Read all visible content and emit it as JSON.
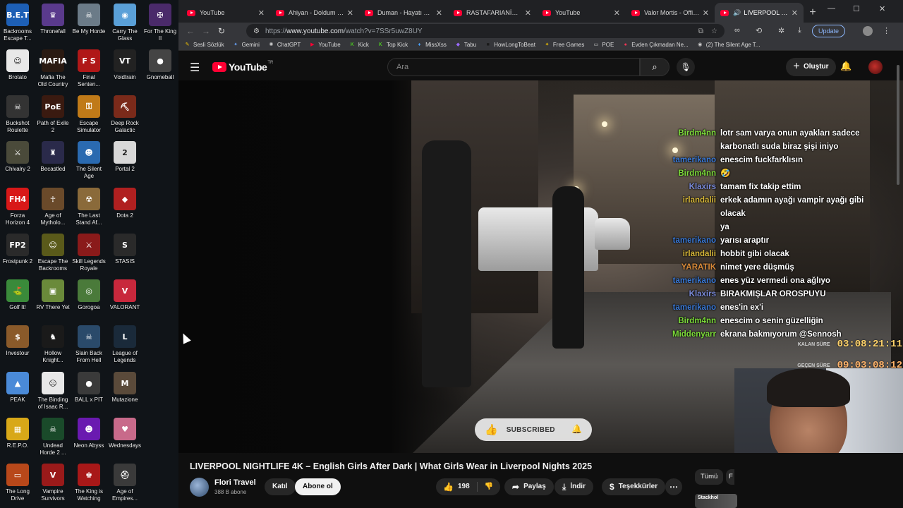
{
  "desktop": {
    "icons": [
      {
        "label": "Backrooms Escape T...",
        "color": "#1d5fb5",
        "glyph": "B.E.T"
      },
      {
        "label": "Thronefall",
        "color": "#5a3a8c",
        "glyph": "♛"
      },
      {
        "label": "Be My Horde",
        "color": "#6b7b88",
        "glyph": "☠"
      },
      {
        "label": "Carry The Glass",
        "color": "#5aa0d8",
        "glyph": "◉"
      },
      {
        "label": "For The King II",
        "color": "#4a2a6a",
        "glyph": "✠"
      },
      {
        "label": "Brotato",
        "color": "#e8e8e8",
        "glyph": "☺"
      },
      {
        "label": "Mafia The Old Country",
        "color": "#2a1a12",
        "glyph": "MAFIA"
      },
      {
        "label": "Final Senten...",
        "color": "#b01818",
        "glyph": "F S"
      },
      {
        "label": "Voidtrain",
        "color": "#222",
        "glyph": "VT"
      },
      {
        "label": "Gnomeball",
        "color": "#444",
        "glyph": "●"
      },
      {
        "label": "Buckshot Roulette",
        "color": "#333",
        "glyph": "☠"
      },
      {
        "label": "Path of Exile 2",
        "color": "#3a1a10",
        "glyph": "PoE"
      },
      {
        "label": "Escape Simulator",
        "color": "#c07a18",
        "glyph": "⚿"
      },
      {
        "label": "Deep Rock Galactic",
        "color": "#7a2a1a",
        "glyph": "⛏"
      },
      {
        "label": "Chivalry 2",
        "color": "#4a4a3a",
        "glyph": "⚔"
      },
      {
        "label": "Becastled",
        "color": "#2a2a4a",
        "glyph": "♜"
      },
      {
        "label": "The Silent Age",
        "color": "#2a6ab0",
        "glyph": "☻"
      },
      {
        "label": "Portal 2",
        "color": "#d8d8d8",
        "glyph": "2"
      },
      {
        "label": "Forza Horizon 4",
        "color": "#d81818",
        "glyph": "FH4"
      },
      {
        "label": "Age of Mytholo...",
        "color": "#6a4a2a",
        "glyph": "☥"
      },
      {
        "label": "The Last Stand Af...",
        "color": "#8a6a3a",
        "glyph": "☢"
      },
      {
        "label": "Dota 2",
        "color": "#b02020",
        "glyph": "◆"
      },
      {
        "label": "Frostpunk 2",
        "color": "#2a2a2a",
        "glyph": "FP2"
      },
      {
        "label": "Escape The Backrooms",
        "color": "#5a5a1a",
        "glyph": "☺"
      },
      {
        "label": "Skill Legends Royale",
        "color": "#8a1a1a",
        "glyph": "⚔"
      },
      {
        "label": "STASIS",
        "color": "#2a2a2a",
        "glyph": "S"
      },
      {
        "label": "Golf It!",
        "color": "#3a8a3a",
        "glyph": "⛳"
      },
      {
        "label": "RV There Yet",
        "color": "#6a8a3a",
        "glyph": "▣"
      },
      {
        "label": "Gorogoa",
        "color": "#4a7a3a",
        "glyph": "◎"
      },
      {
        "label": "VALORANT",
        "color": "#c8283c",
        "glyph": "V"
      },
      {
        "label": "Investour",
        "color": "#8a5a2a",
        "glyph": "$"
      },
      {
        "label": "Hollow Knight...",
        "color": "#1a1a1a",
        "glyph": "♞"
      },
      {
        "label": "Slain Back From Hell",
        "color": "#2a4a6a",
        "glyph": "☠"
      },
      {
        "label": "League of Legends",
        "color": "#1a2a3a",
        "glyph": "L"
      },
      {
        "label": "PEAK",
        "color": "#4a8ad8",
        "glyph": "▲"
      },
      {
        "label": "The Binding of Isaac R...",
        "color": "#e8e8e8",
        "glyph": "☹"
      },
      {
        "label": "BALL x PIT",
        "color": "#3a3a3a",
        "glyph": "●"
      },
      {
        "label": "Mutazione",
        "color": "#5a4a3a",
        "glyph": "M"
      },
      {
        "label": "R.E.P.O.",
        "color": "#d8a818",
        "glyph": "▦"
      },
      {
        "label": "Undead Horde 2 ...",
        "color": "#1a4a2a",
        "glyph": "☠"
      },
      {
        "label": "Neon Abyss",
        "color": "#6a1ab0",
        "glyph": "☻"
      },
      {
        "label": "Wednesdays",
        "color": "#c86a8a",
        "glyph": "♥"
      },
      {
        "label": "The Long Drive",
        "color": "#b8481a",
        "glyph": "▭"
      },
      {
        "label": "Vampire Survivors",
        "color": "#9a1a1a",
        "glyph": "V"
      },
      {
        "label": "The King is Watching",
        "color": "#a81818",
        "glyph": "♚"
      },
      {
        "label": "Age of Empires...",
        "color": "#3a3a3a",
        "glyph": "⛑"
      }
    ]
  },
  "browser": {
    "tabs": [
      {
        "title": "YouTube",
        "active": false
      },
      {
        "title": "Ahiyan - Doldum (Offici...",
        "active": false
      },
      {
        "title": "Duman - Hayatı Yaşa - Y...",
        "active": false
      },
      {
        "title": "RASTAFARIANİZM: Bilgi...",
        "active": false
      },
      {
        "title": "YouTube",
        "active": false
      },
      {
        "title": "Valor Mortis - Official T...",
        "active": false
      },
      {
        "title": "LIVERPOOL NIGHTLIFE...",
        "active": true
      }
    ],
    "new_tab": "+",
    "window_controls": {
      "minimize": "—",
      "maximize": "☐",
      "close": "✕"
    },
    "nav": {
      "back": "←",
      "forward": "→",
      "reload": "↻"
    },
    "url_prefix": "https://",
    "url_host": "www.youtube.com",
    "url_path": "/watch?v=7SSr5uwZ8UY",
    "update_label": "Update",
    "bookmarks": [
      {
        "label": "Sesli Sözlük",
        "icon": "✎",
        "color": "#f2c200"
      },
      {
        "label": "Gemini",
        "icon": "✦",
        "color": "#6aa6ff"
      },
      {
        "label": "ChatGPT",
        "icon": "✺",
        "color": "#cfcfcf"
      },
      {
        "label": "YouTube",
        "icon": "▶",
        "color": "#ff0033"
      },
      {
        "label": "Kick",
        "icon": "K",
        "color": "#53fc18"
      },
      {
        "label": "Top Kick",
        "icon": "K",
        "color": "#53fc18"
      },
      {
        "label": "MissXss",
        "icon": "♦",
        "color": "#4aa3ff"
      },
      {
        "label": "Tabu",
        "icon": "◆",
        "color": "#9a6aff"
      },
      {
        "label": "HowLongToBeat",
        "icon": "■",
        "color": "#1a1a1a"
      },
      {
        "label": "Free Games",
        "icon": "✦",
        "color": "#f2c200"
      },
      {
        "label": "POE",
        "icon": "▭",
        "color": "#cfcfcf"
      },
      {
        "label": "Evden Çıkmadan Ne...",
        "icon": "●",
        "color": "#ff3355"
      },
      {
        "label": "(2) The Silent Age T...",
        "icon": "◉",
        "color": "#cfcfcf"
      }
    ]
  },
  "youtube": {
    "logo_text": "YouTube",
    "region": "TR",
    "search_placeholder": "Ara",
    "create_label": "Oluştur",
    "video": {
      "title": "LIVERPOOL NIGHTLIFE 4K – English Girls After Dark | What Girls Wear in Liverpool Nights 2025",
      "channel": "Flori Travel",
      "subscribers": "388 B abone",
      "join_label": "Katıl",
      "subscribe_label": "Abone ol",
      "likes": "198",
      "share_label": "Paylaş",
      "download_label": "İndir",
      "thanks_label": "Teşekkürler",
      "more_label": "⋯",
      "toast_label": "SUBSCRIBED"
    },
    "overlay_chat": [
      {
        "nick": "Birdm4nn",
        "msg": "lotr sam varya onun ayakları sadece",
        "color": "#7ddc3a"
      },
      {
        "nick": "",
        "msg": "karbonatlı suda biraz şişi iniyo",
        "color": "#7ddc3a"
      },
      {
        "nick": "tamerikano",
        "msg": "enescim fuckfarklısın",
        "color": "#3a7ad8"
      },
      {
        "nick": "Birdm4nn",
        "msg": "🤣",
        "color": "#7ddc3a"
      },
      {
        "nick": "Klaxirs",
        "msg": "tamam fix takip ettim",
        "color": "#7a8ad8"
      },
      {
        "nick": "irlandalii",
        "msg": "erkek adamın ayağı vampir ayağı gibi olacak",
        "color": "#d8b83a"
      },
      {
        "nick": "",
        "msg": "ya",
        "color": "#d8b83a"
      },
      {
        "nick": "tamerikano",
        "msg": "yarısı araptır",
        "color": "#3a7ad8"
      },
      {
        "nick": "irlandalii",
        "msg": "hobbit gibi olacak",
        "color": "#d8b83a"
      },
      {
        "nick": "YARATIK",
        "msg": "nimet yere düşmüş",
        "color": "#d88a3a"
      },
      {
        "nick": "tamerikano",
        "msg": "enes yüz vermedi ona ağlıyo",
        "color": "#3a7ad8"
      },
      {
        "nick": "Klaxirs",
        "msg": "BIRAKMIŞLAR OROSPUYU",
        "color": "#7a8ad8"
      },
      {
        "nick": "tamerikano",
        "msg": "enes'in ex'i",
        "color": "#3a7ad8"
      },
      {
        "nick": "Birdm4nn",
        "msg": "enescim o senin güzelliğin",
        "color": "#7ddc3a"
      },
      {
        "nick": "Middenyarr",
        "msg": "ekrana bakmıyorum @Sennosh",
        "color": "#7ddc3a"
      }
    ],
    "timers": [
      {
        "label": "KALAN SÜRE",
        "value": "03:08:21:11"
      },
      {
        "label": "GEÇEN SÜRE",
        "value": "09:03:08:12"
      }
    ],
    "side_chip_all": "Tümü",
    "side_chip_next": "F",
    "related_thumb_text": "Stackhol"
  }
}
